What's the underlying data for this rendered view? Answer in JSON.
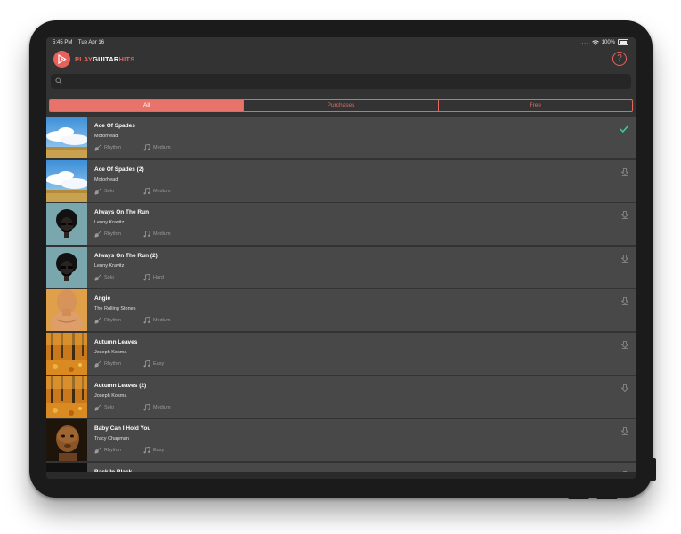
{
  "status_bar": {
    "time": "5:45 PM",
    "date": "Tue Apr 16",
    "battery": "100%"
  },
  "app": {
    "logo_play": "PLAY",
    "logo_guitar": "GUITAR",
    "logo_hits": "HITS",
    "help_icon": "question-mark-icon"
  },
  "search": {
    "placeholder": "",
    "value": ""
  },
  "tabs": [
    {
      "label": "All",
      "active": true
    },
    {
      "label": "Purchases",
      "active": false
    },
    {
      "label": "Free",
      "active": false
    }
  ],
  "songs": [
    {
      "title": "Ace Of Spades",
      "artist": "Motorhead",
      "part": "Rhythm",
      "level": "Medium",
      "action": "checkmark-icon",
      "art": "sky"
    },
    {
      "title": "Ace Of Spades (2)",
      "artist": "Motorhead",
      "part": "Solo",
      "level": "Medium",
      "action": "download-icon",
      "art": "sky"
    },
    {
      "title": "Always On The Run",
      "artist": "Lenny Kravitz",
      "part": "Rhythm",
      "level": "Medium",
      "action": "download-icon",
      "art": "afro"
    },
    {
      "title": "Always On The Run (2)",
      "artist": "Lenny Kravitz",
      "part": "Solo",
      "level": "Hard",
      "action": "download-icon",
      "art": "afro"
    },
    {
      "title": "Angie",
      "artist": "The Rolling Stones",
      "part": "Rhythm",
      "level": "Medium",
      "action": "download-icon",
      "art": "portrait"
    },
    {
      "title": "Autumn Leaves",
      "artist": "Joseph Kosma",
      "part": "Rhythm",
      "level": "Easy",
      "action": "download-icon",
      "art": "autumn"
    },
    {
      "title": "Autumn Leaves (2)",
      "artist": "Joseph Kosma",
      "part": "Solo",
      "level": "Medium",
      "action": "download-icon",
      "art": "autumn"
    },
    {
      "title": "Baby Can I Hold You",
      "artist": "Tracy Chapman",
      "part": "Rhythm",
      "level": "Easy",
      "action": "download-icon",
      "art": "child"
    },
    {
      "title": "Back In Black",
      "artist": "",
      "part": "",
      "level": "",
      "action": "download-icon",
      "art": "dark"
    }
  ],
  "colors": {
    "accent": "#e8625d",
    "row_bg": "#484848",
    "screen_bg": "#333333"
  }
}
